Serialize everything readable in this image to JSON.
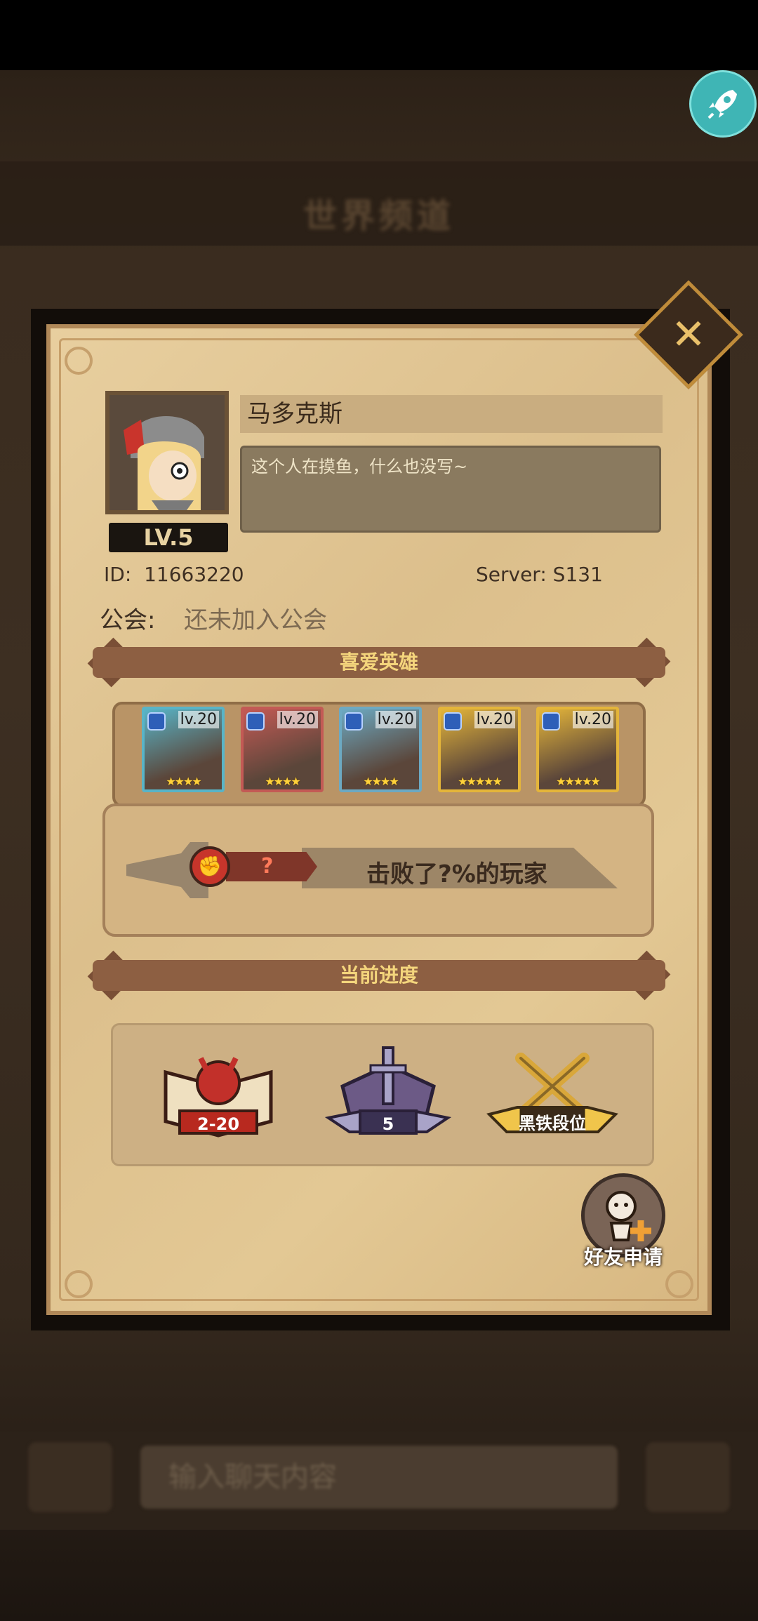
{
  "background": {
    "header_title": "世界频道",
    "input_placeholder": "输入聊天内容"
  },
  "profile": {
    "name": "马多克斯",
    "signature": "这个人在摸鱼，什么也没写~",
    "level": "LV.5",
    "id_label": "ID:",
    "id_value": "11663220",
    "server_label": "Server:",
    "server_value": "S131",
    "guild_label": "公会:",
    "guild_value": "还未加入公会"
  },
  "favorite_heroes": {
    "title": "喜爱英雄",
    "heroes": [
      {
        "level": "lv.20",
        "stars": "★★★★",
        "frame_color": "#58b4c7",
        "element_color": "#2e5fb8"
      },
      {
        "level": "lv.20",
        "stars": "★★★★",
        "frame_color": "#c35a55",
        "element_color": "#2e5fb8"
      },
      {
        "level": "lv.20",
        "stars": "★★★★",
        "frame_color": "#6ca9c2",
        "element_color": "#2e5fb8"
      },
      {
        "level": "lv.20",
        "stars": "★★★★★",
        "frame_color": "#e4b53a",
        "element_color": "#2e5fb8"
      },
      {
        "level": "lv.20",
        "stars": "★★★★★",
        "frame_color": "#e4b53a",
        "element_color": "#2e5fb8"
      }
    ],
    "rank_value": "?",
    "defeat_text": "击败了?%的玩家"
  },
  "progress": {
    "title": "当前进度",
    "items": [
      {
        "label": "2-20",
        "icon": "campaign-book-icon"
      },
      {
        "label": "5",
        "icon": "tower-sword-icon"
      },
      {
        "label": "黑铁段位",
        "icon": "arena-rank-icon"
      }
    ]
  },
  "friend_request": {
    "label": "好友申请"
  },
  "colors": {
    "panel": "#e3c894",
    "banner": "#8d5f42",
    "banner_text": "#f4d57c",
    "accent_red": "#c7352b"
  }
}
